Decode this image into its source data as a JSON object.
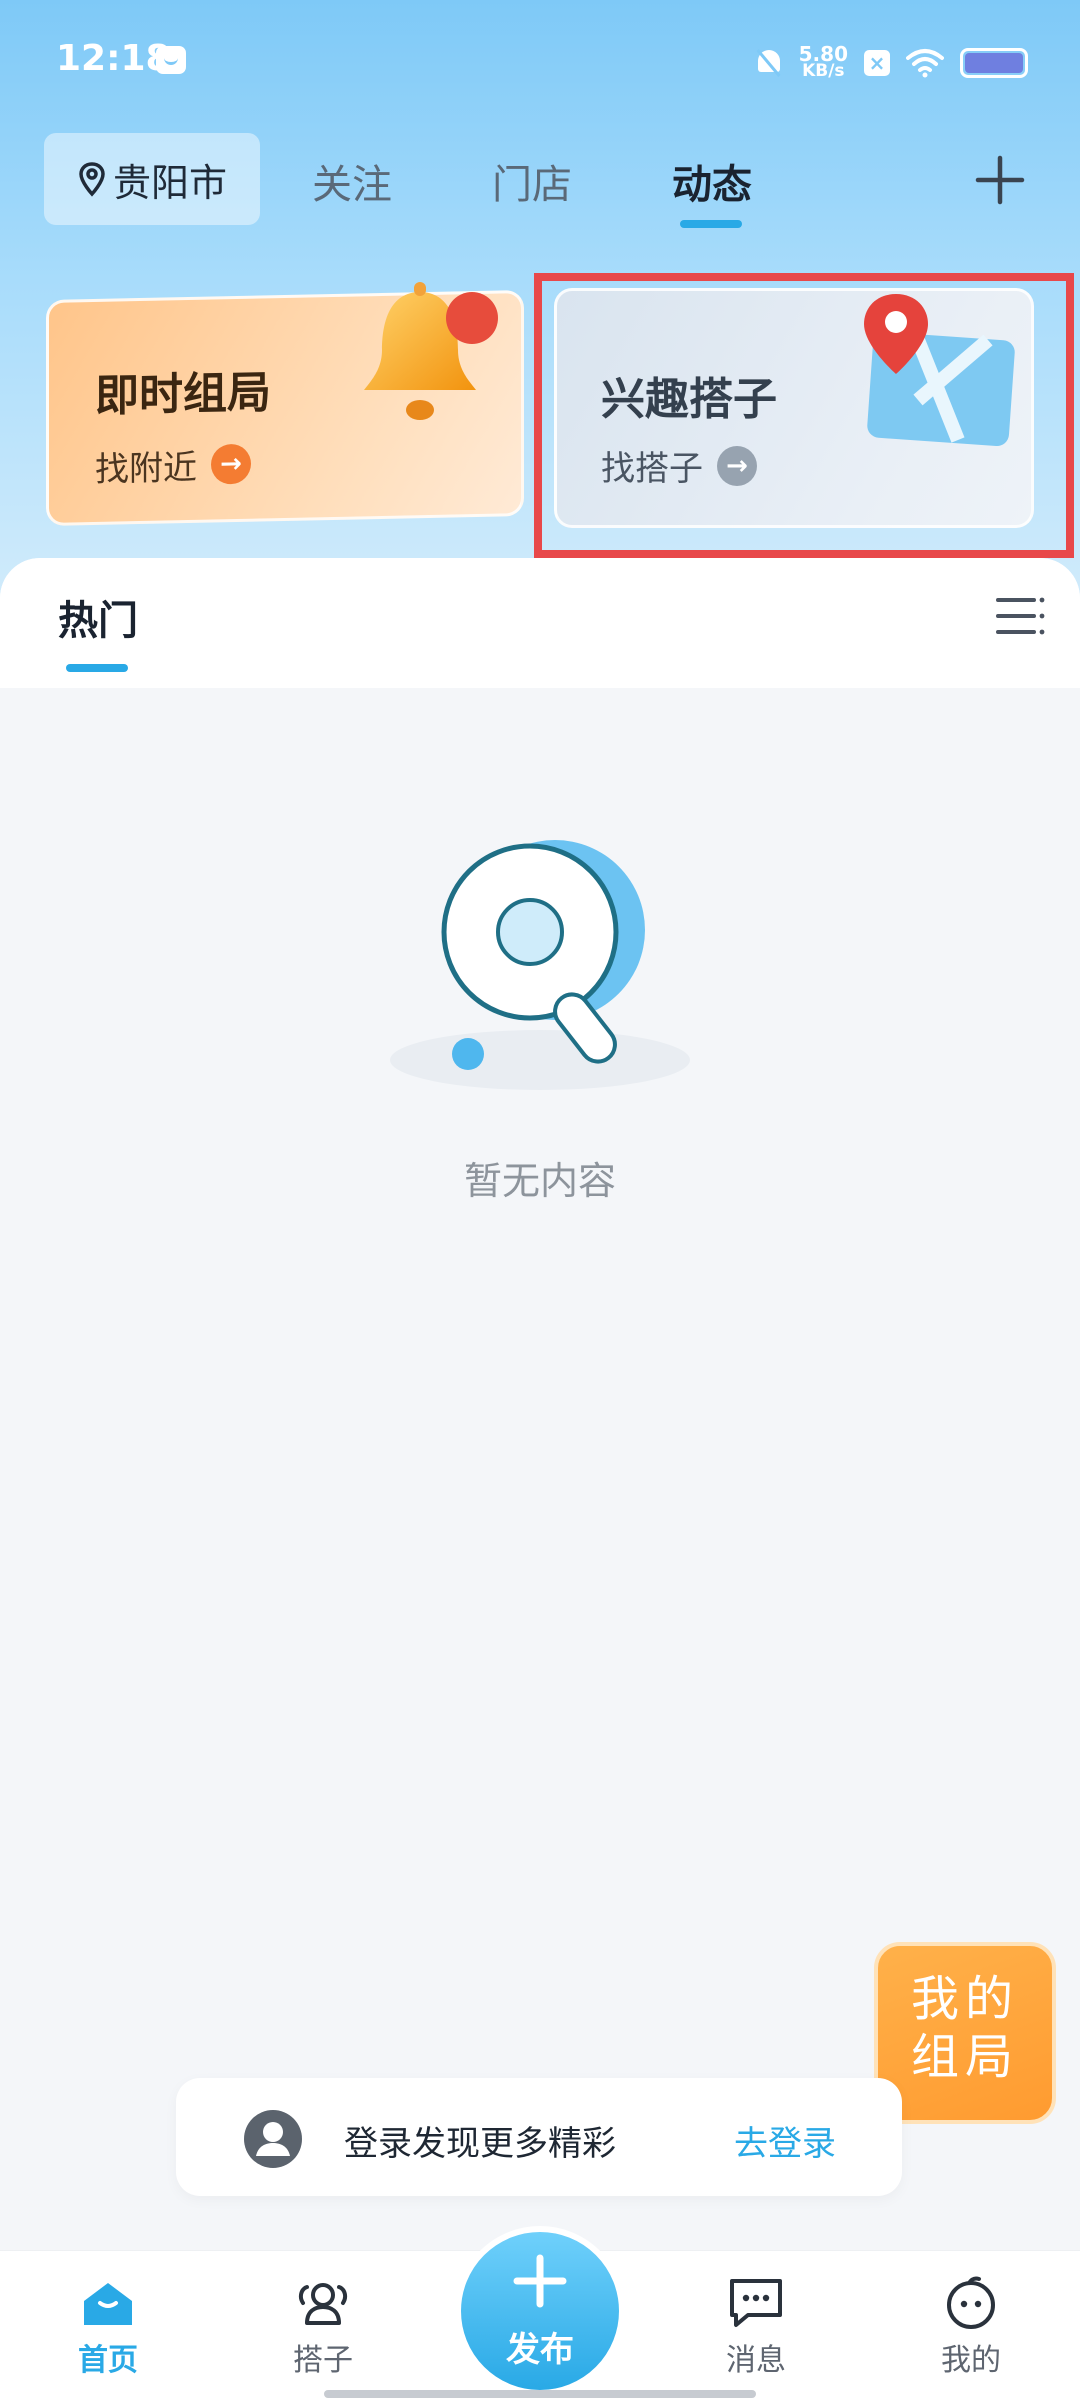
{
  "status_bar": {
    "time": "12:18",
    "net_speed_value": "5.80",
    "net_speed_unit": "KB/s",
    "battery_icon": "battery-icon"
  },
  "top_nav": {
    "city": "贵阳市",
    "tabs": [
      {
        "label": "关注",
        "active": false
      },
      {
        "label": "门店",
        "active": false
      },
      {
        "label": "动态",
        "active": true
      }
    ]
  },
  "cards": [
    {
      "title": "即时组局",
      "subtitle": "找附近",
      "icon": "bell-icon"
    },
    {
      "title": "兴趣搭子",
      "subtitle": "找搭子",
      "icon": "map-pin-icon"
    }
  ],
  "feed": {
    "tab": "热门",
    "empty_text": "暂无内容"
  },
  "float_button": {
    "line1": "我的",
    "line2": "组局"
  },
  "login_banner": {
    "text": "登录发现更多精彩",
    "action": "去登录"
  },
  "bottom_nav": {
    "items": [
      {
        "label": "首页",
        "icon": "home-icon",
        "active": true
      },
      {
        "label": "搭子",
        "icon": "partners-icon",
        "active": false
      },
      {
        "label": "发布",
        "icon": "plus-icon",
        "active": false
      },
      {
        "label": "消息",
        "icon": "message-icon",
        "active": false
      },
      {
        "label": "我的",
        "icon": "profile-icon",
        "active": false
      }
    ]
  },
  "colors": {
    "accent": "#29a9e6",
    "highlight_border": "#e8484a",
    "float_orange": "#ff9b30"
  }
}
